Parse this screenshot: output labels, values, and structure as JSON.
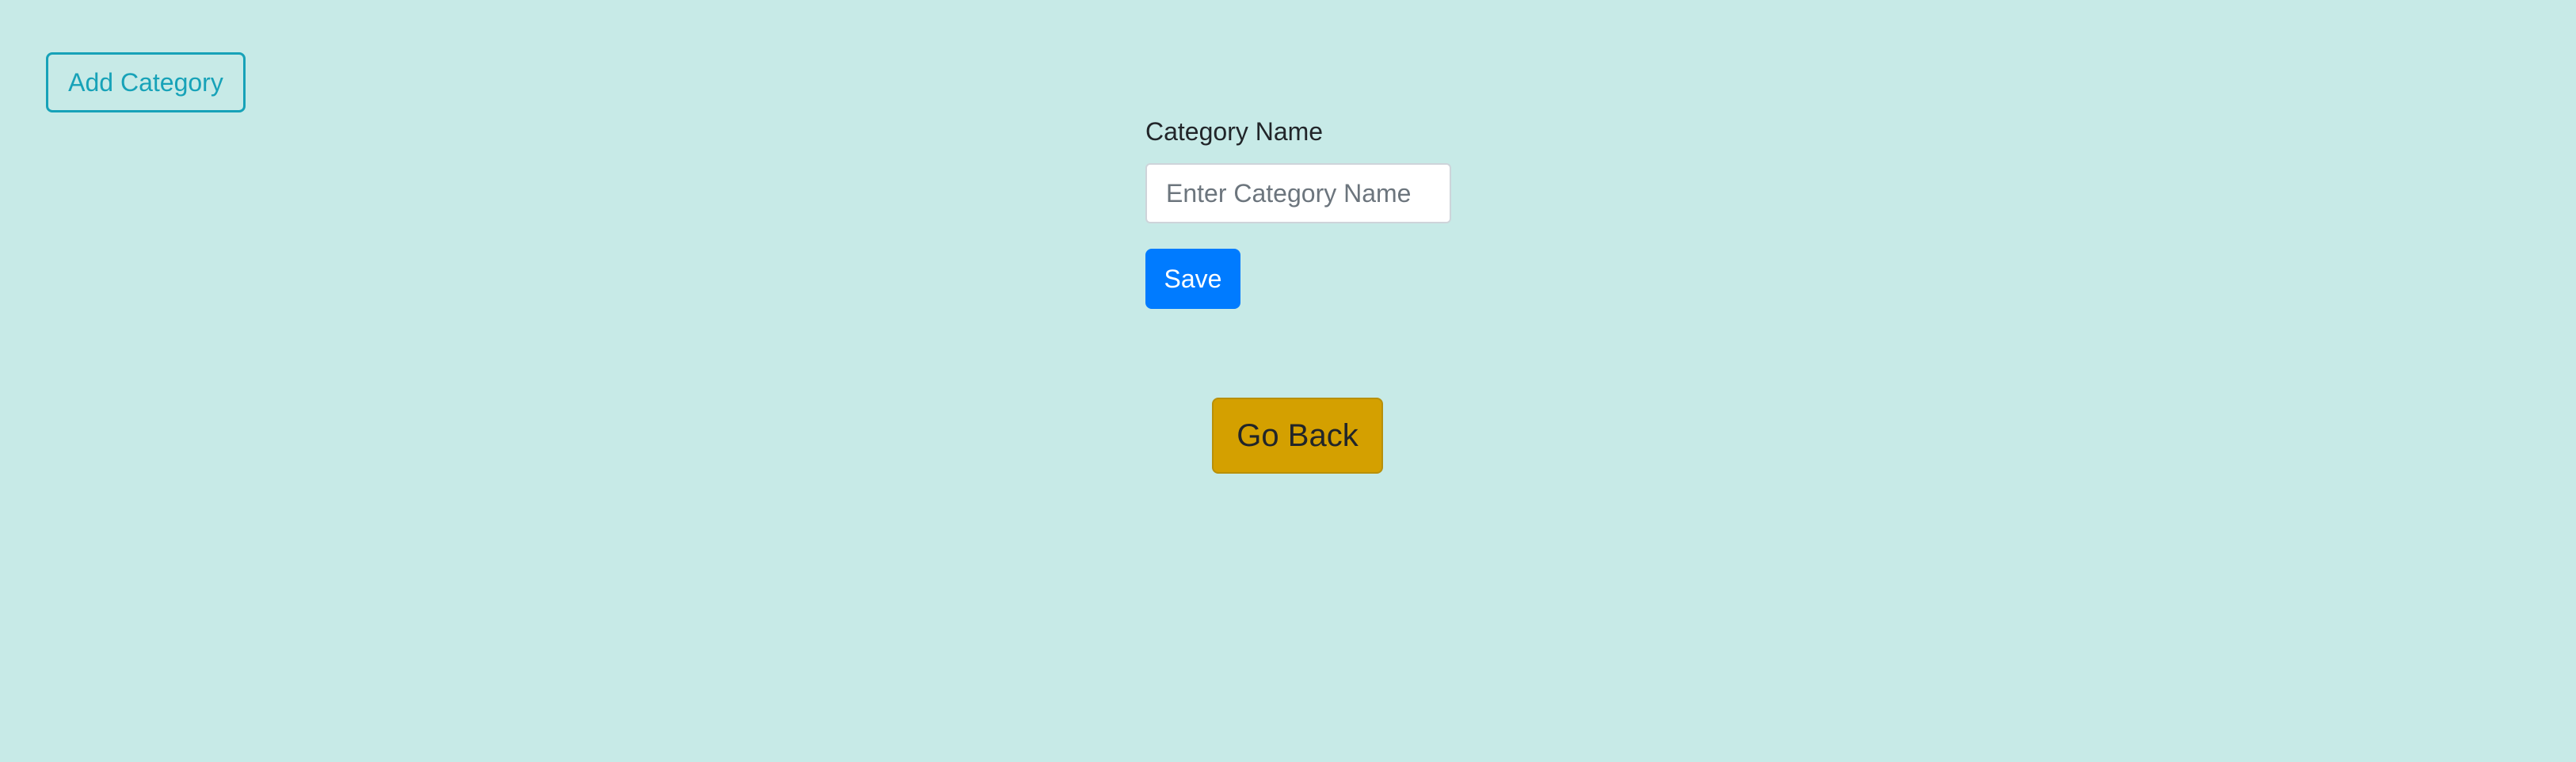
{
  "header": {
    "add_category_label": "Add Category"
  },
  "form": {
    "category_name_label": "Category Name",
    "category_name_placeholder": "Enter Category Name",
    "category_name_value": "",
    "save_label": "Save"
  },
  "footer": {
    "go_back_label": "Go Back"
  },
  "colors": {
    "background": "#c7eae7",
    "info": "#17a2b8",
    "primary": "#007bff",
    "warning": "#d4a000"
  }
}
